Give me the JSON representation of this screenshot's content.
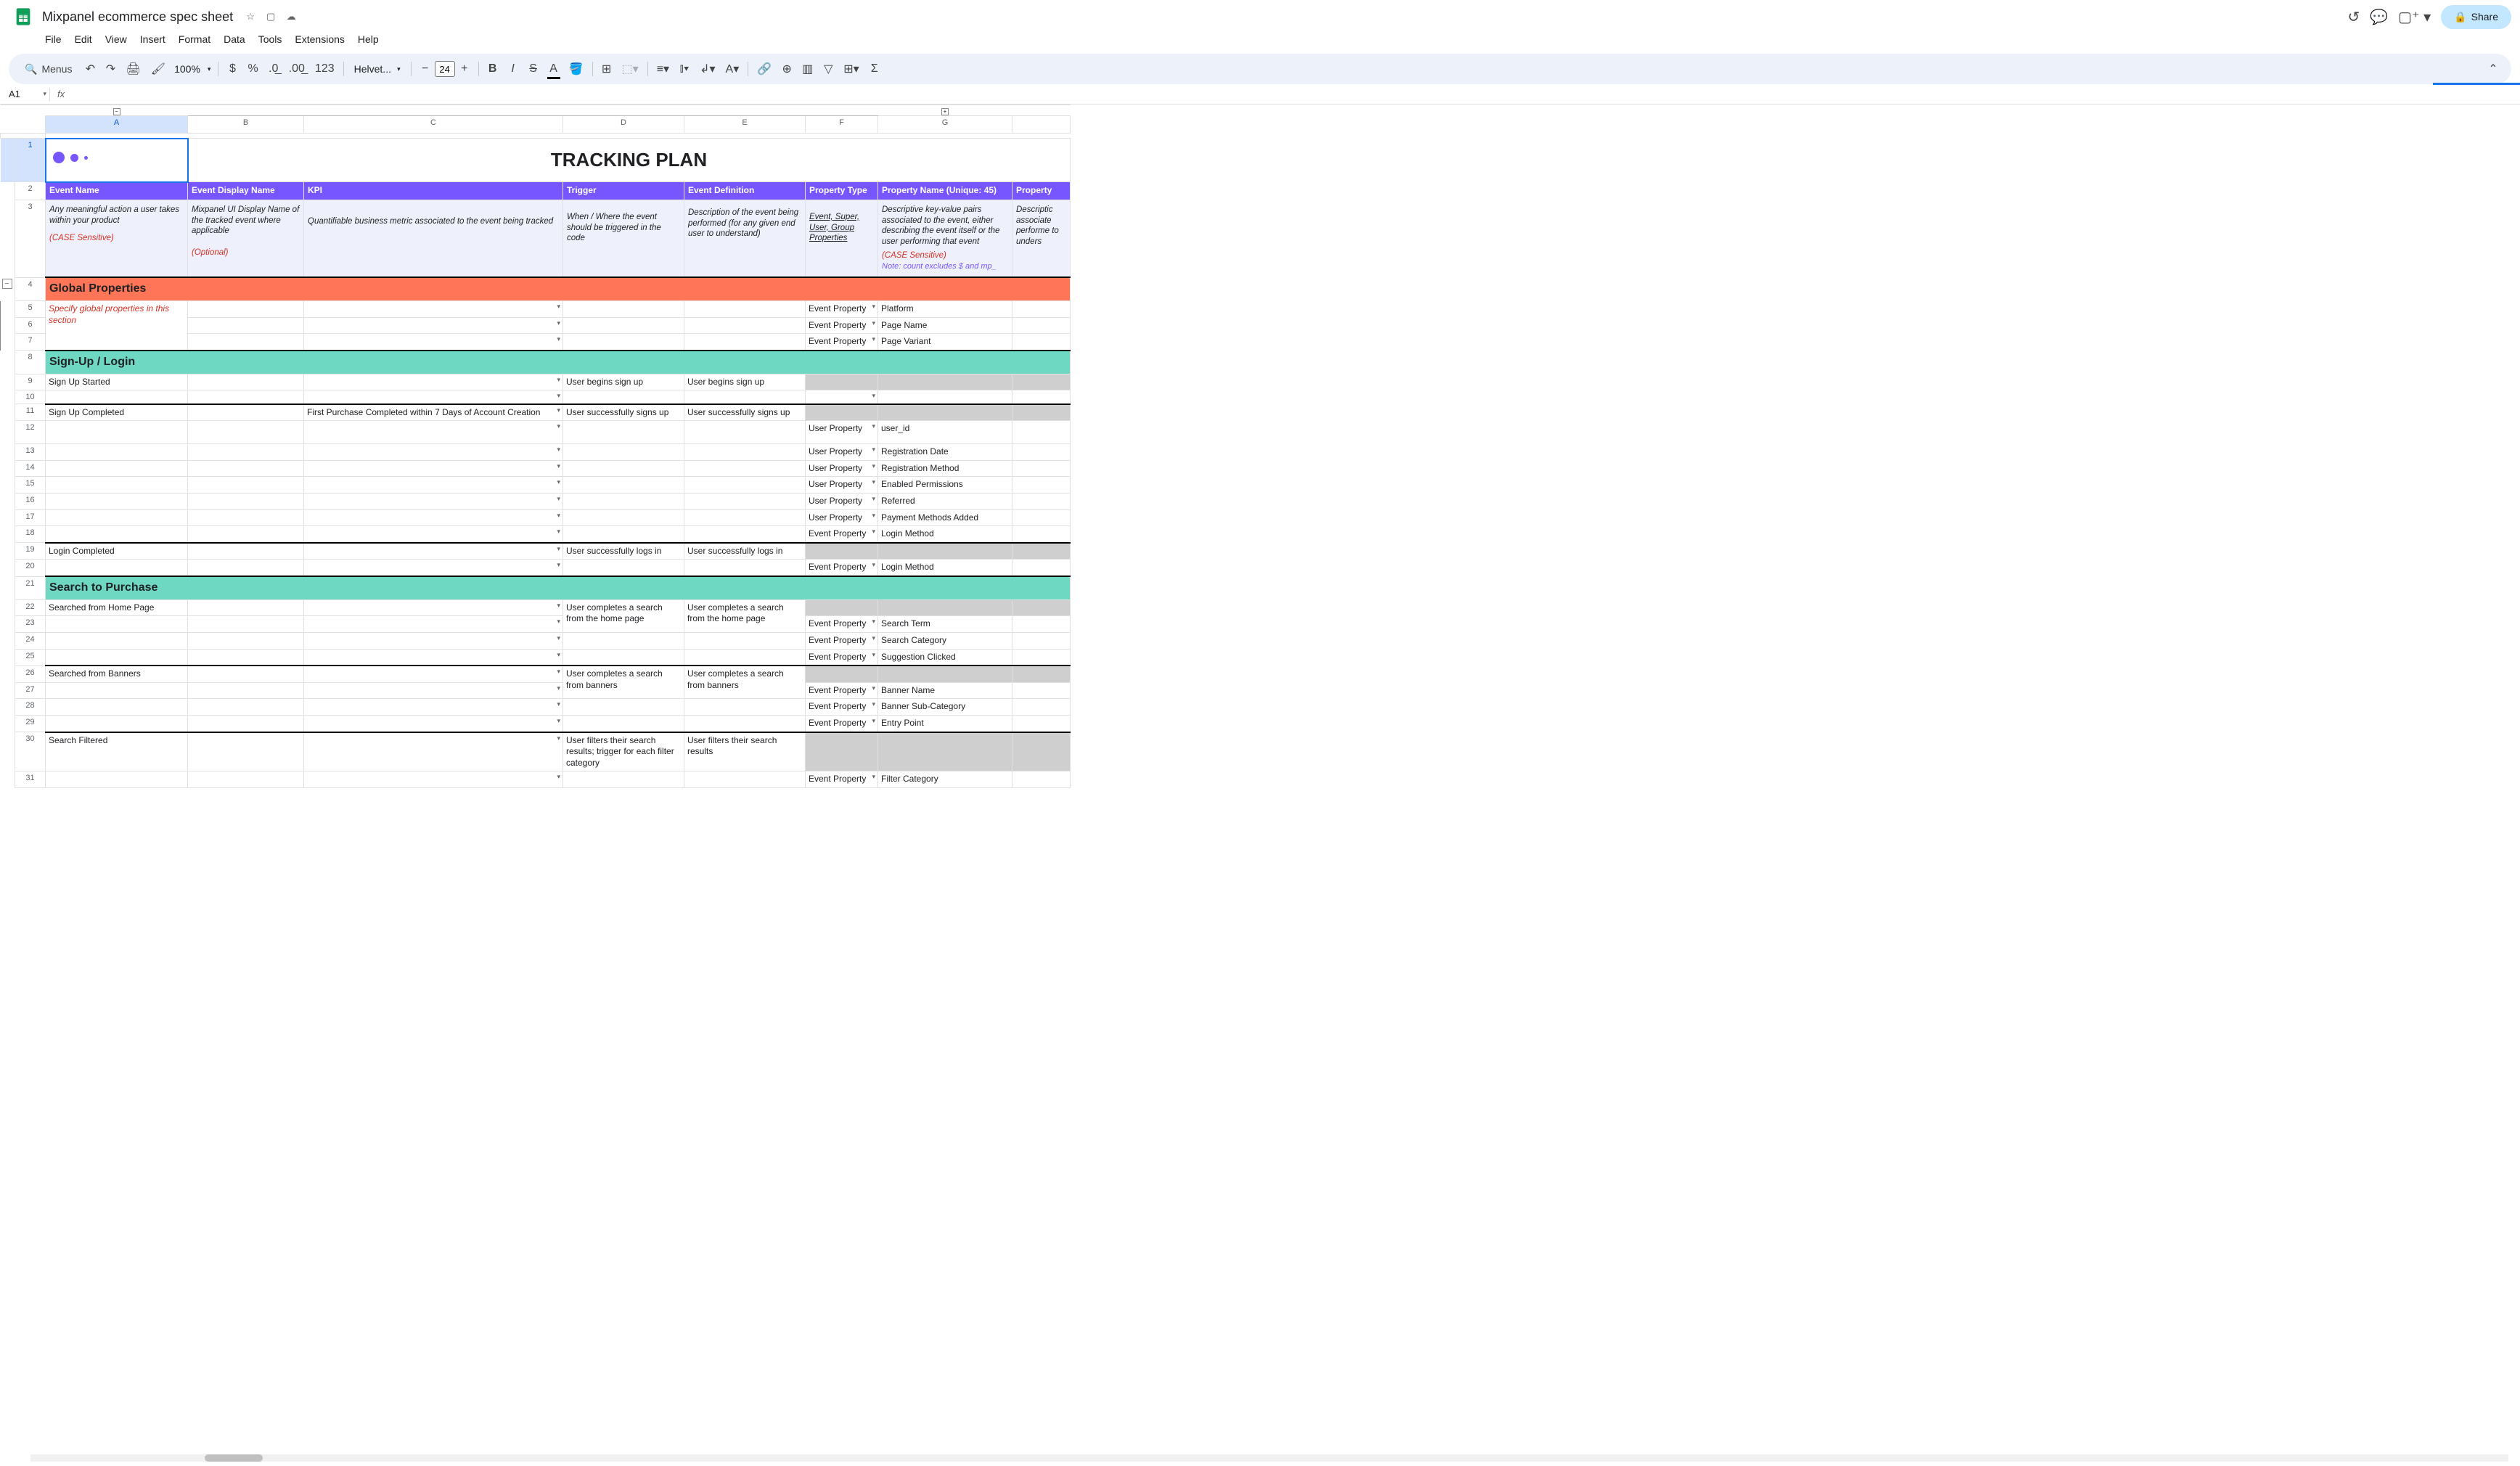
{
  "doc": {
    "title": "Mixpanel ecommerce spec sheet",
    "share_label": "Share"
  },
  "menus": [
    "File",
    "Edit",
    "View",
    "Insert",
    "Format",
    "Data",
    "Tools",
    "Extensions",
    "Help"
  ],
  "toolbar": {
    "search_label": "Menus",
    "zoom": "100%",
    "font": "Helvet...",
    "font_size": "24"
  },
  "namebox": "A1",
  "columns": [
    "A",
    "B",
    "C",
    "D",
    "E",
    "F",
    "G"
  ],
  "title_row": "TRACKING PLAN",
  "headers": {
    "A": "Event Name",
    "B": "Event Display Name",
    "C": "KPI",
    "D": "Trigger",
    "E": "Event Definition",
    "F": "Property Type",
    "G": "Property Name (Unique: 45)",
    "H": "Property"
  },
  "desc": {
    "A_main": "Any meaningful action a user takes within your product",
    "A_note": "(CASE Sensitive)",
    "B_main": "Mixpanel UI Display Name of the tracked event where applicable",
    "B_note": "(Optional)",
    "C": "Quantifiable business metric associated to the event being tracked",
    "D": "When / Where the event should be triggered in the code",
    "E": "Description of the event being performed (for any given end user to understand)",
    "F": "Event, Super, User, Group Properties",
    "G_main": "Descriptive key-value pairs associated to the event, either describing the event itself or the user performing that event",
    "G_note1": "(CASE Sensitive)",
    "G_note2": "Note: count excludes $ and mp_",
    "H": "Descriptic associate performe to unders"
  },
  "sections": {
    "global": "Global Properties",
    "global_note": "Specify global properties in this section",
    "signup": "Sign-Up / Login",
    "search": "Search to Purchase"
  },
  "rows": {
    "r5": {
      "F": "Event Property",
      "G": "Platform"
    },
    "r6": {
      "F": "Event Property",
      "G": "Page Name"
    },
    "r7": {
      "F": "Event Property",
      "G": "Page Variant"
    },
    "r9": {
      "A": "Sign Up Started",
      "D": "User begins sign up",
      "E": "User begins sign up"
    },
    "r11": {
      "A": "Sign Up Completed",
      "C": "First Purchase Completed within 7 Days of Account Creation",
      "D": "User successfully signs up",
      "E": "User successfully signs up"
    },
    "r12": {
      "F": "User Property",
      "G": "user_id"
    },
    "r13": {
      "F": "User Property",
      "G": "Registration Date"
    },
    "r14": {
      "F": "User Property",
      "G": "Registration Method"
    },
    "r15": {
      "F": "User Property",
      "G": "Enabled Permissions"
    },
    "r16": {
      "F": "User Property",
      "G": "Referred"
    },
    "r17": {
      "F": "User Property",
      "G": "Payment Methods Added"
    },
    "r18": {
      "F": "Event Property",
      "G": "Login Method"
    },
    "r19": {
      "A": "Login Completed",
      "D": "User successfully logs in",
      "E": "User successfully logs in"
    },
    "r20": {
      "F": "Event Property",
      "G": "Login Method"
    },
    "r22": {
      "A": "Searched from Home Page",
      "D": "User completes a search from the home page",
      "E": "User completes a search from the home page"
    },
    "r23": {
      "F": "Event Property",
      "G": "Search Term"
    },
    "r24": {
      "F": "Event Property",
      "G": "Search Category"
    },
    "r25": {
      "F": "Event Property",
      "G": "Suggestion Clicked"
    },
    "r26": {
      "A": "Searched from Banners",
      "D": "User completes a search from banners",
      "E": "User completes a search from banners"
    },
    "r27": {
      "F": "Event Property",
      "G": "Banner Name"
    },
    "r28": {
      "F": "Event Property",
      "G": "Banner Sub-Category"
    },
    "r29": {
      "F": "Event Property",
      "G": "Entry Point"
    },
    "r30": {
      "A": "Search Filtered",
      "D": "User filters their search results; trigger for each filter category",
      "E": "User filters their search results"
    },
    "r31": {
      "F": "Event Property",
      "G": "Filter Category"
    }
  }
}
